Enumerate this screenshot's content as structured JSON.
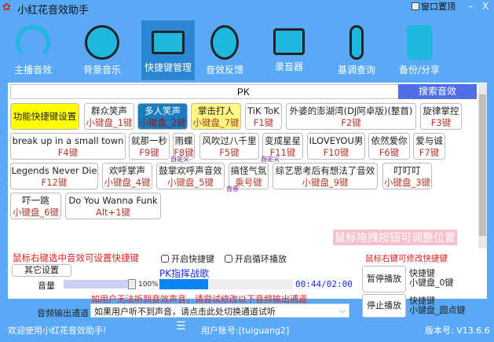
{
  "app": {
    "title": "小红花音效助手",
    "pin_label": "窗口置顶",
    "minimize": "–",
    "close": "X"
  },
  "nav": [
    {
      "label": "主播音效",
      "icon": "headphones-icon"
    },
    {
      "label": "背景音乐",
      "icon": "music-disc-icon"
    },
    {
      "label": "快捷键管理",
      "icon": "keyboard-icon"
    },
    {
      "label": "音效反馈",
      "icon": "webcam-icon"
    },
    {
      "label": "录音器",
      "icon": "cassette-icon"
    },
    {
      "label": "基调查询",
      "icon": "microphone-icon"
    },
    {
      "label": "备份/分享",
      "icon": "database-upload-icon"
    }
  ],
  "search": {
    "value": "PK",
    "button": "搜索音效"
  },
  "sounds": [
    {
      "name": "功能快捷键设置",
      "key": ""
    },
    {
      "name": "群众笑声",
      "key": "小键盘_1键"
    },
    {
      "name": "多人笑声",
      "key": "小键盘_2键"
    },
    {
      "name": "掌击打人",
      "key": "小键盘_7键"
    },
    {
      "name": "TiK ToK",
      "key": "F1键"
    },
    {
      "name": "外婆的澎湖湾(DJ阿卓版)(整首)",
      "key": "F2键"
    },
    {
      "name": "旋律掌控",
      "key": "F3键"
    },
    {
      "name": "break up in a small town",
      "key": "F4键"
    },
    {
      "name": "就那一秒",
      "key": "F9键"
    },
    {
      "name": "雨蝶",
      "key": "F8键"
    },
    {
      "name": "风吹过八千里",
      "key": "F5键"
    },
    {
      "name": "变成星星",
      "key": "F11键"
    },
    {
      "name": "ILOVEYOU男",
      "key": "F10键"
    },
    {
      "name": "依然爱你",
      "key": "F6键"
    },
    {
      "name": "爱与诚",
      "key": "F7键"
    },
    {
      "name": "Legends Never Die",
      "key": "F12键"
    },
    {
      "name": "欢呼掌声",
      "key": "小键盘_4键"
    },
    {
      "name": "鼓掌欢呼声音效",
      "key": "小键盘_5键"
    },
    {
      "name": "搞怪气氛",
      "key": "乘号键"
    },
    {
      "name": "综艺思考后有想法了音效",
      "key": "小键盘_9键"
    },
    {
      "name": "叮叮叮",
      "key": "小键盘_3键"
    },
    {
      "name": "吓一跳",
      "key": "小键盘_6键"
    },
    {
      "name": "Do You Wanna Funk",
      "key": "Alt+1键"
    }
  ],
  "tags": {
    "custom1": "自定义",
    "custom2": "自定义",
    "bg": "背景"
  },
  "drag_hint": "鼠标拖拽按钮可调整位置",
  "right_click_hint": "鼠标右键选中音效可设置快捷键",
  "enable_hotkey": "开启快捷键",
  "enable_loop": "开启循环播放",
  "other_settings": "其它设置",
  "now_playing": "PK指挥战歌",
  "volume": {
    "label": "音量",
    "value": "100%",
    "fraction": 1.0
  },
  "progress": {
    "time": "00:44/02:00",
    "fraction": 0.367
  },
  "warning": "如用户无法听到音效声音，请尝试修改以下音频输出通道",
  "output": {
    "label": "音频输出通道",
    "value": "如果用户听不到声音，请点击此处切换通道试听"
  },
  "modify_hint": "鼠标右键可修改快捷键",
  "pause": {
    "label": "暂停播放",
    "hotkey": "快捷键",
    "key": "小键盘_0键"
  },
  "stop": {
    "label": "停止播放",
    "hotkey": "快捷键",
    "key": "小键盘_圆点键"
  },
  "status": {
    "welcome": "欢迎使用小红花音效助手!",
    "account": "用户账号:[tuiguang2]",
    "version": "版本号: V13.6.6"
  }
}
